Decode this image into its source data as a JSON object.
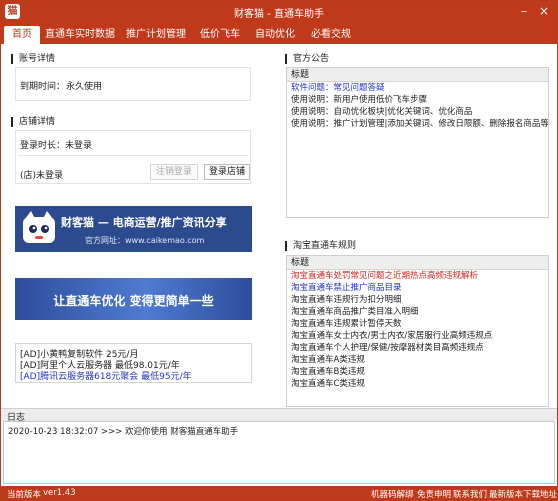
{
  "window": {
    "title": "财客猫 - 直通车助手",
    "logo_text": "猫",
    "minimize": "–",
    "close": "×"
  },
  "tabs": [
    {
      "label": "首页",
      "active": true
    },
    {
      "label": "直通车实时数据"
    },
    {
      "label": "推广计划管理"
    },
    {
      "label": "低价飞车"
    },
    {
      "label": "自动优化"
    },
    {
      "label": "必看交规"
    }
  ],
  "account": {
    "section_title": "账号详情",
    "expire_label": "到期时间：",
    "expire_value": "永久使用"
  },
  "store": {
    "section_title": "店铺详情",
    "login_label": "登录时长：未登录",
    "store_status": "(店)未登录",
    "logout_button": "注销登录",
    "login_button": "登录店铺"
  },
  "banners": {
    "b1_brand": "财客猫 — 电商运营/推广资讯分享",
    "b1_url": "官方网址：www.caikemao.com",
    "b2_text": "让直通车优化 变得更简单一些"
  },
  "ads": [
    {
      "text": "[AD]小黄鸭复制软件 25元/月"
    },
    {
      "text": "[AD]阿里个人云服务器 最低98.01元/年"
    },
    {
      "text": "[AD]腾讯云服务器618元聚会 最低95元/年"
    }
  ],
  "announcements": {
    "section_title": "官方公告",
    "header": "标题",
    "rows": [
      {
        "text": "软件问题：常见问题答疑"
      },
      {
        "text": "使用说明：新用户使用低价飞车步骤"
      },
      {
        "text": "使用说明：自动优化板块|优化关键词、优化商品"
      },
      {
        "text": "使用说明：推广计划管理|添加关键词、修改日限额、删除报名商品等"
      }
    ]
  },
  "rules": {
    "section_title": "淘宝直通车规则",
    "header": "标题",
    "rows": [
      {
        "text": "淘宝直通车处罚常见问题之近期热点高频违规解析"
      },
      {
        "text": "淘宝直通车禁止推广商品目录"
      },
      {
        "text": "淘宝直通车违规行为扣分明细"
      },
      {
        "text": "淘宝直通车商品推广类目准入明细"
      },
      {
        "text": "淘宝直通车违规累计暂停天数"
      },
      {
        "text": "淘宝直通车女士内衣/男士内衣/家居服行业高频违规点"
      },
      {
        "text": "淘宝直通车个人护理/保健/按摩器材类目高频违规点"
      },
      {
        "text": "淘宝直通车A类违规"
      },
      {
        "text": "淘宝直通车B类违规"
      },
      {
        "text": "淘宝直通车C类违规"
      }
    ]
  },
  "log": {
    "title": "日志",
    "lines": [
      {
        "text": "2020-10-23  18:32:07  >>>  欢迎你使用 财客猫直通车助手"
      }
    ]
  },
  "status": {
    "version_label": "当前版本",
    "version_value": "ver1.43",
    "links": [
      "机器码解绑",
      "免责申明",
      "联系我们",
      "最新版本下载地址"
    ]
  },
  "colors": {
    "brand": "#c0391b",
    "link_blue": "#2233cc",
    "link_red": "#d8241d"
  }
}
